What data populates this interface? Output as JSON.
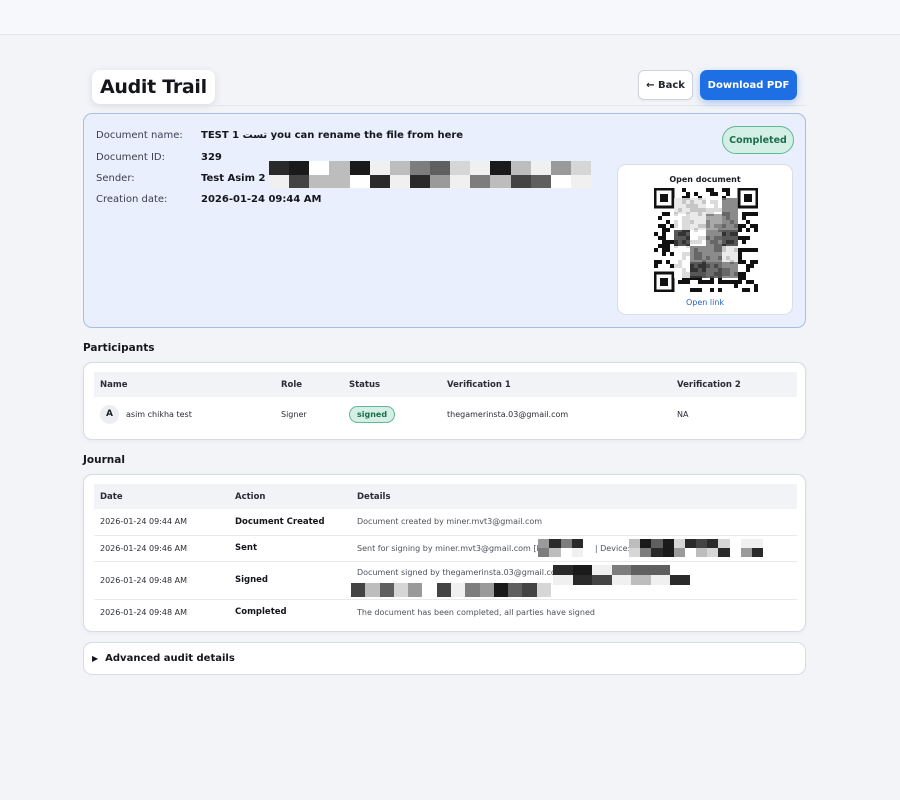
{
  "header": {
    "title": "Audit Trail",
    "back_label": "← Back",
    "download_label": "Download PDF"
  },
  "document": {
    "name_label": "Document name:",
    "name_value": "TEST 1 تست you can rename the file from here",
    "id_label": "Document ID:",
    "id_value": "329",
    "sender_label": "Sender:",
    "sender_value": "Test Asim 2",
    "date_label": "Creation date:",
    "date_value": "2026-01-24 09:44 AM",
    "status": "Completed",
    "qr_title": "Open document",
    "qr_link": "Open link"
  },
  "participants": {
    "title": "Participants",
    "columns": [
      "Name",
      "Role",
      "Status",
      "Verification 1",
      "Verification 2"
    ],
    "rows": [
      {
        "initial": "A",
        "name": "asim chikha test",
        "role": "Signer",
        "status": "signed",
        "verification1": "thegamerinsta.03@gmail.com",
        "verification2": "NA"
      }
    ]
  },
  "journal": {
    "title": "Journal",
    "columns": [
      "Date",
      "Action",
      "Details"
    ],
    "rows": [
      {
        "date": "2026-01-24 09:44 AM",
        "action": "Document Created",
        "details": "Document created by miner.mvt3@gmail.com"
      },
      {
        "date": "2026-01-24 09:46 AM",
        "action": "Sent",
        "details": "Sent for signing by miner.mvt3@gmail.com [IP: ",
        "details_mid": "| Device: 6I"
      },
      {
        "date": "2026-01-24 09:48 AM",
        "action": "Signed",
        "details": "Document signed by thegamerinsta.03@gmail.com"
      },
      {
        "date": "2026-01-24 09:48 AM",
        "action": "Completed",
        "details": "The document has been completed, all parties have signed"
      }
    ]
  },
  "advanced": {
    "label": "Advanced audit details"
  },
  "colors": {
    "accent": "#1e6fe4",
    "success_bg": "#d4efe5",
    "success_text": "#1d6e4b",
    "doc_card_bg": "#e9effc"
  },
  "icons": {
    "advanced_toggle": "triangle-right-icon",
    "qr": "qr-code-icon"
  }
}
